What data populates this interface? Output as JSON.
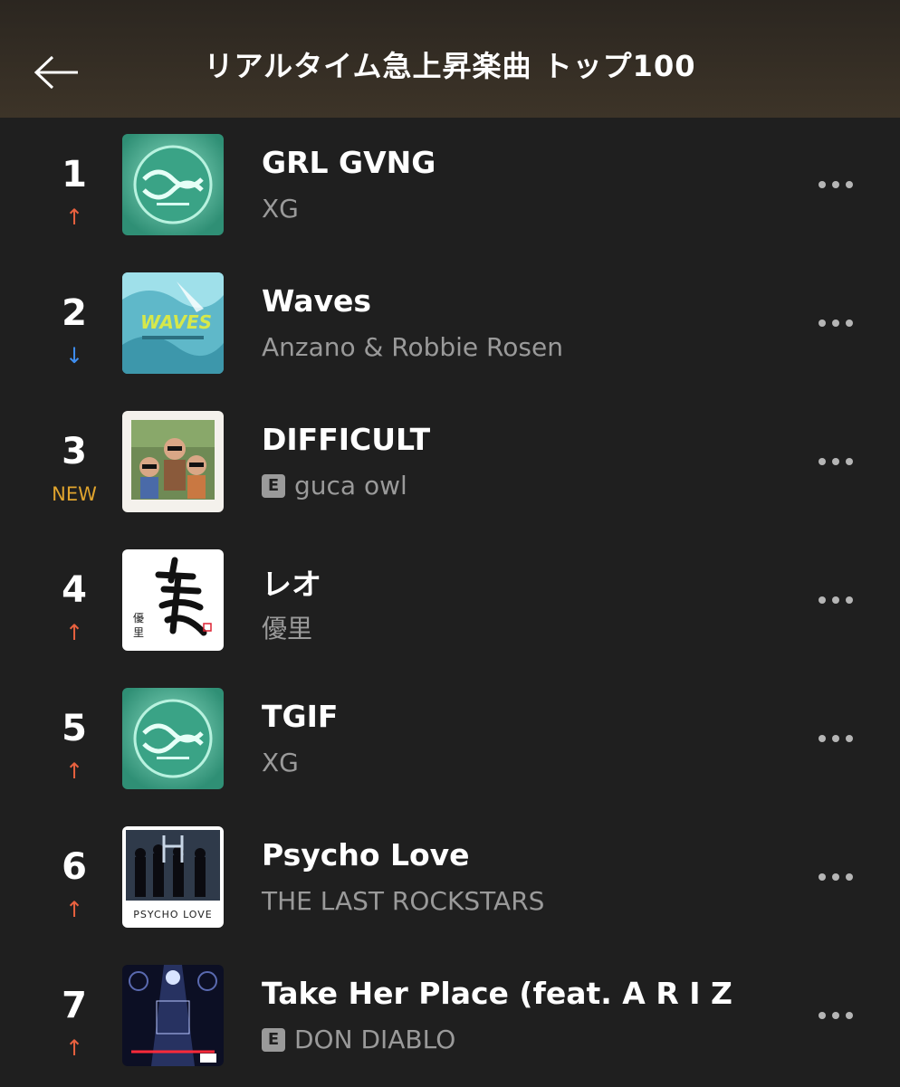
{
  "header": {
    "title": "リアルタイム急上昇楽曲 トップ100",
    "back_icon": "arrow-left-icon"
  },
  "songs": [
    {
      "rank": "1",
      "change": "↑",
      "change_type": "up",
      "title": "GRL GVNG",
      "artist": "XG",
      "explicit": false,
      "art": "xg"
    },
    {
      "rank": "2",
      "change": "↓",
      "change_type": "down",
      "title": "Waves",
      "artist": "Anzano & Robbie Rosen",
      "explicit": false,
      "art": "waves"
    },
    {
      "rank": "3",
      "change": "NEW",
      "change_type": "new",
      "title": "DIFFICULT",
      "artist": "guca owl",
      "explicit": true,
      "explicit_label": "E",
      "art": "difficult"
    },
    {
      "rank": "4",
      "change": "↑",
      "change_type": "up",
      "title": "レオ",
      "artist": "優里",
      "explicit": false,
      "art": "leo"
    },
    {
      "rank": "5",
      "change": "↑",
      "change_type": "up",
      "title": "TGIF",
      "artist": "XG",
      "explicit": false,
      "art": "xg"
    },
    {
      "rank": "6",
      "change": "↑",
      "change_type": "up",
      "title": "Psycho Love",
      "artist": "THE LAST ROCKSTARS",
      "explicit": false,
      "art": "psycho",
      "art_text": "PSYCHO LOVE"
    },
    {
      "rank": "7",
      "change": "↑",
      "change_type": "up",
      "title": "Take Her Place (feat. A R I Z...",
      "artist": "DON DIABLO",
      "explicit": true,
      "explicit_label": "E",
      "art": "diablo"
    }
  ],
  "colors": {
    "background": "#1f1f1f",
    "up": "#e8613f",
    "down": "#3f8ef0",
    "new": "#e0a42e",
    "secondary_text": "#9a9a9a"
  },
  "icons": {
    "more": "more-dots-icon",
    "explicit": "explicit-badge-icon"
  }
}
